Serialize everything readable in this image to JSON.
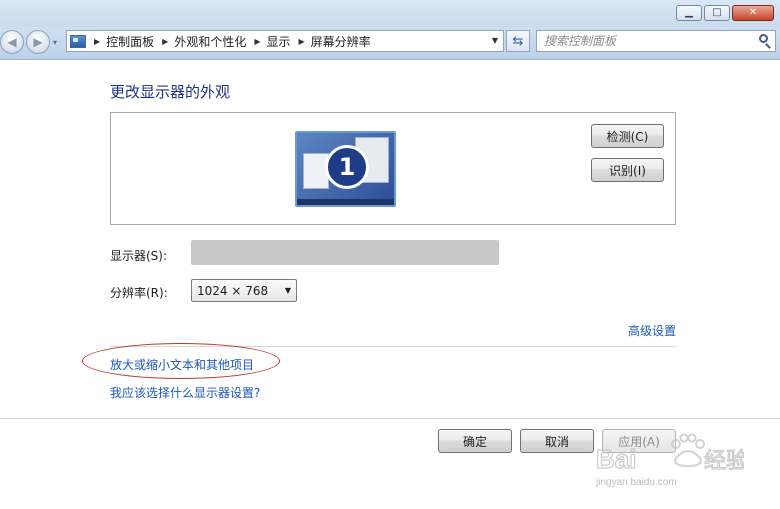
{
  "window": {
    "minimize_glyph": "▁",
    "maximize_glyph": "□",
    "close_glyph": "✕"
  },
  "nav": {
    "back_glyph": "◀",
    "forward_glyph": "▶",
    "dropdown_glyph": "▾",
    "breadcrumbs": [
      "控制面板",
      "外观和个性化",
      "显示",
      "屏幕分辨率"
    ],
    "breadcrumb_sep": "▶",
    "address_dropdown_glyph": "▼",
    "refresh_glyph": "⇆",
    "search_placeholder": "搜索控制面板"
  },
  "main": {
    "title": "更改显示器的外观",
    "monitor_number": "1",
    "detect_label": "检测(C)",
    "identify_label": "识别(I)",
    "display_label": "显示器(S):",
    "display_value": "",
    "resolution_label": "分辨率(R):",
    "resolution_value": "1024 × 768",
    "resolution_arrow": "▼",
    "advanced_link": "高级设置",
    "text_size_link": "放大或缩小文本和其他项目",
    "which_settings_link": "我应该选择什么显示器设置?"
  },
  "footer": {
    "ok_label": "确定",
    "cancel_label": "取消",
    "apply_label": "应用(A)"
  },
  "watermark": {
    "brand": "Baidu经验",
    "url": "jingyan.baidu.com"
  },
  "colors": {
    "link": "#1b58b8",
    "title": "#1e3287",
    "annotation_ellipse": "#c0362c"
  }
}
